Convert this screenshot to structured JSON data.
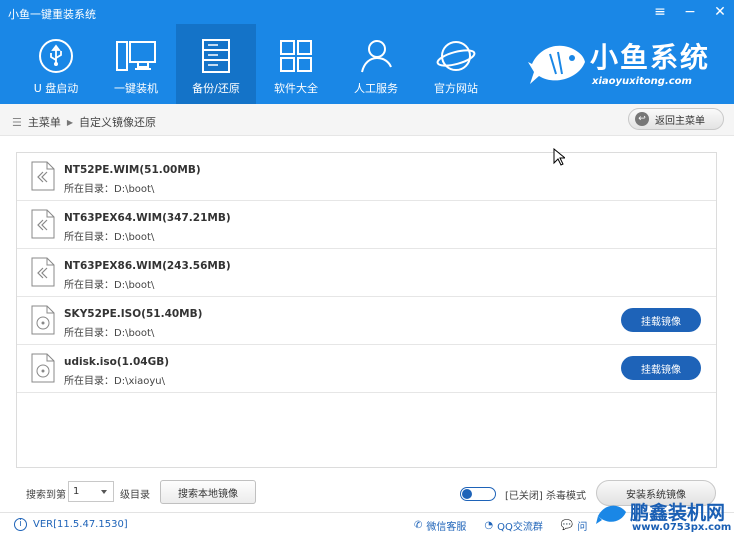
{
  "window": {
    "title": "小鱼一键重装系统"
  },
  "nav": [
    {
      "label": "U 盘启动",
      "icon": "usb-icon"
    },
    {
      "label": "一键装机",
      "icon": "monitor-icon"
    },
    {
      "label": "备份/还原",
      "icon": "server-icon",
      "active": true
    },
    {
      "label": "软件大全",
      "icon": "grid-icon"
    },
    {
      "label": "人工服务",
      "icon": "person-icon"
    },
    {
      "label": "官方网站",
      "icon": "globe-icon"
    }
  ],
  "brand": {
    "name": "小鱼系统",
    "url": "xiaoyuxitong.com"
  },
  "breadcrumb": {
    "root": "主菜单",
    "current": "自定义镜像还原"
  },
  "back_button": "返回主菜单",
  "files": [
    {
      "name": "NT52PE.WIM(51.00MB)",
      "dir": "所在目录：D:\\boot\\",
      "type": "wim",
      "mount": ""
    },
    {
      "name": "NT63PEX64.WIM(347.21MB)",
      "dir": "所在目录：D:\\boot\\",
      "type": "wim",
      "mount": ""
    },
    {
      "name": "NT63PEX86.WIM(243.56MB)",
      "dir": "所在目录：D:\\boot\\",
      "type": "wim",
      "mount": ""
    },
    {
      "name": "SKY52PE.ISO(51.40MB)",
      "dir": "所在目录：D:\\boot\\",
      "type": "iso",
      "mount": "挂载镜像"
    },
    {
      "name": "udisk.iso(1.04GB)",
      "dir": "所在目录：D:\\xiaoyu\\",
      "type": "iso",
      "mount": "挂载镜像"
    }
  ],
  "search": {
    "label": "搜索到第",
    "level": "1",
    "suffix": "级目录",
    "local_button": "搜索本地镜像"
  },
  "antivirus": {
    "label": "[已关闭] 杀毒模式"
  },
  "install_button": "安装系统镜像",
  "status": {
    "version": "VER[11.5.47.1530]",
    "wechat": "微信客服",
    "qq": "QQ交流群",
    "question": "问"
  },
  "watermark": {
    "title": "鹏鑫装机网",
    "url": "www.0753px.com"
  },
  "colors": {
    "header": "#1a87e6",
    "active_tab": "#1473c8",
    "button": "#1e63b8"
  }
}
